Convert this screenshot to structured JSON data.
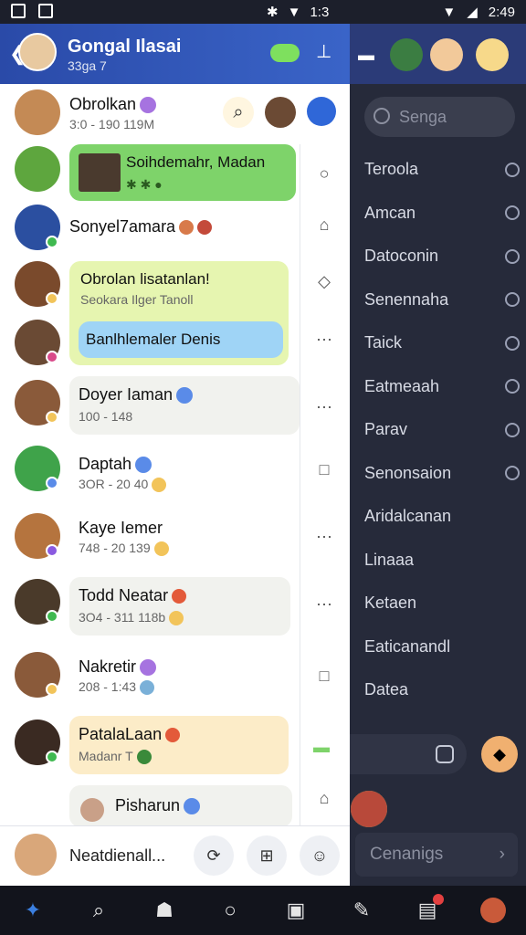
{
  "status_bar": {
    "time": "2:49",
    "center_text": "1:3"
  },
  "header": {
    "title": "Gongal Ilasai",
    "subtitle": "33ga 7"
  },
  "top_chat": {
    "name": "Obrolkan",
    "meta": "3:0 - 190 119M"
  },
  "chats": [
    {
      "name": "Soihdemahr, Madan",
      "meta": ""
    },
    {
      "name": "Sonyel7amara",
      "meta": ""
    },
    {
      "name": "Obrolan lisatanlan!",
      "meta": "Seokara Ilger Tanoll"
    },
    {
      "name": "Banlhlemaler Denis",
      "meta": ""
    },
    {
      "name": "Doyer Iaman",
      "meta": "100 - 148"
    },
    {
      "name": "Daptah",
      "meta": "3OR - 20 40"
    },
    {
      "name": "Kaye Iemer",
      "meta": "748 - 20 139"
    },
    {
      "name": "Todd Neatar",
      "meta": "3O4 - 311 118b"
    },
    {
      "name": "Nakretir",
      "meta": "208 - 1:43"
    },
    {
      "name": "PatalaLaan",
      "meta": "Madanr T"
    },
    {
      "name": "Pisharun",
      "meta": ""
    }
  ],
  "footer": {
    "name": "Neatdienall..."
  },
  "dark_panel": {
    "search_placeholder": "Senga",
    "items": [
      "Teroola",
      "Amcan",
      "Datoconin",
      "Senennaha",
      "Taick",
      "Eatmeaah",
      "Parav",
      "Senonsaion",
      "Aridalcanan",
      "Linaaa",
      "Ketaen",
      "Eaticanandl",
      "Datea"
    ],
    "bottom_label": "Cenanigs"
  },
  "colors": {
    "header": "#2a4aa8",
    "green_bubble": "#7ed36a",
    "lime_bubble": "#e6f5b0",
    "blue_bubble": "#9fd4f6",
    "cream_bubble": "#fcecc8",
    "dark_bg": "#262a3a"
  },
  "icons": [
    "search-icon",
    "back-icon",
    "pin-icon",
    "home-icon",
    "mic-icon",
    "camera-icon",
    "circle-icon",
    "more-icon",
    "square-icon"
  ]
}
